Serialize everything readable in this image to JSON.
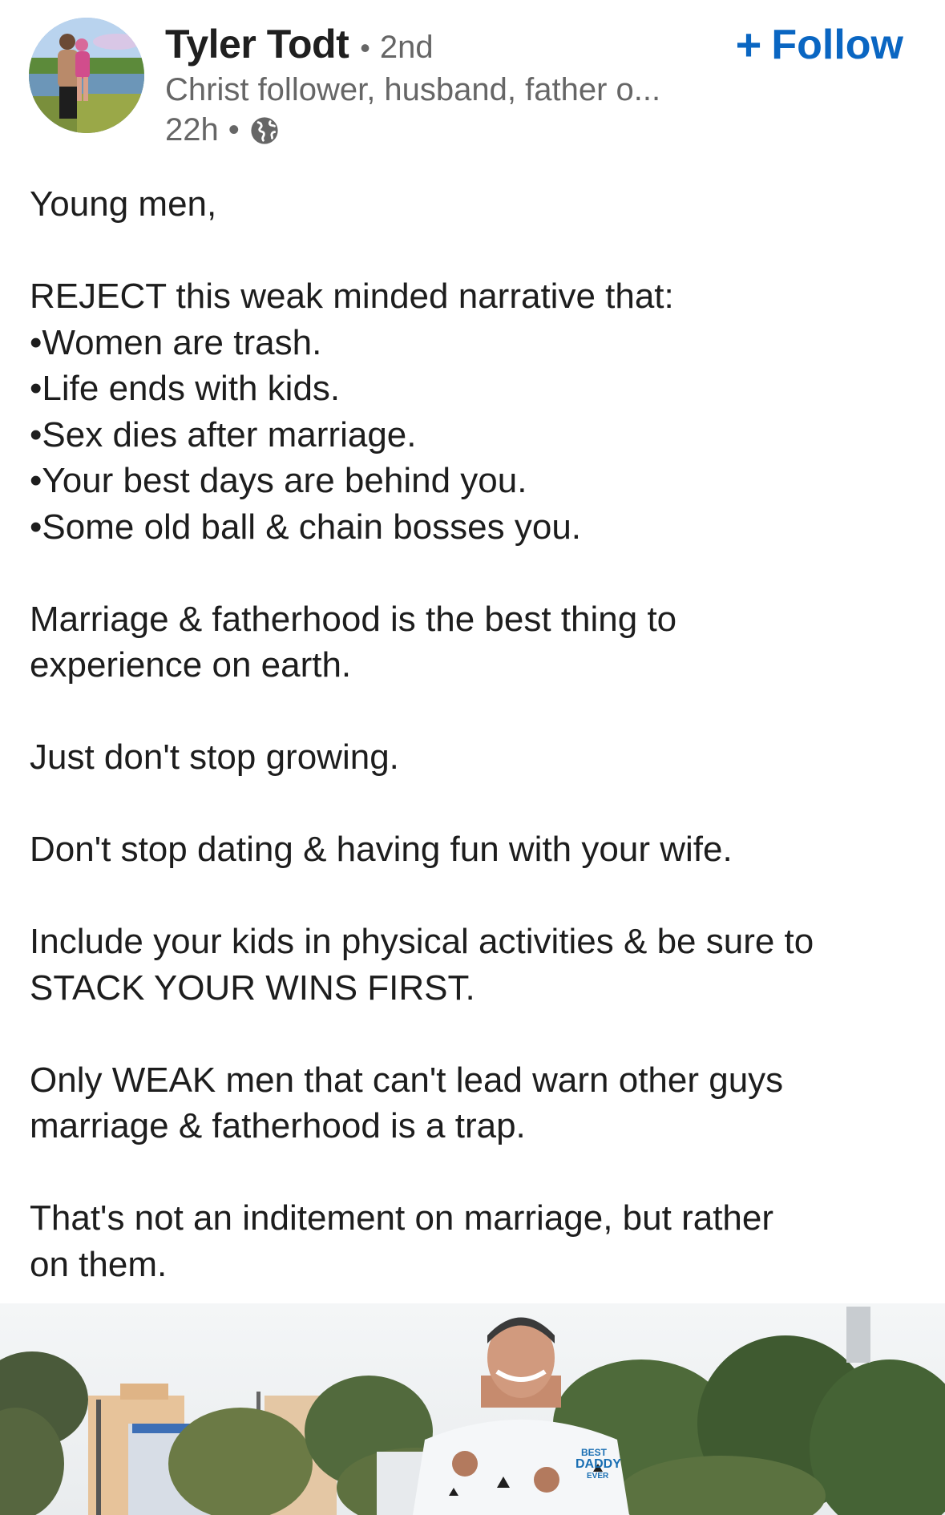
{
  "author": {
    "name": "Tyler Todt",
    "degree": "2nd",
    "separator": "•",
    "headline": "Christ follower, husband, father o...",
    "time": "22h",
    "visibility_icon": "globe-icon"
  },
  "follow": {
    "plus": "+",
    "label": "Follow"
  },
  "post": {
    "lines": [
      "Young men,",
      "",
      "REJECT this weak minded narrative that:",
      "•Women are trash.",
      "•Life ends with kids.",
      "•Sex dies after marriage.",
      "•Your best days are behind you.",
      "•Some old ball & chain bosses you.",
      "",
      "Marriage & fatherhood is the best thing to",
      "experience on earth.",
      "",
      "Just don't stop growing.",
      "",
      "Don't stop dating & having fun with your wife.",
      "",
      "Include your kids in physical activities & be sure to",
      "STACK YOUR WINS FIRST.",
      "",
      "Only WEAK men that can't lead warn other guys",
      "marriage & fatherhood is a trap.",
      "",
      "That's not an inditement on marriage, but rather",
      "on them."
    ]
  },
  "media": {
    "shirt_text": [
      "BEST",
      "DADDY",
      "EVER"
    ]
  },
  "colors": {
    "accent": "#0a66c2",
    "text": "#1d1d1d",
    "muted": "#666666"
  }
}
